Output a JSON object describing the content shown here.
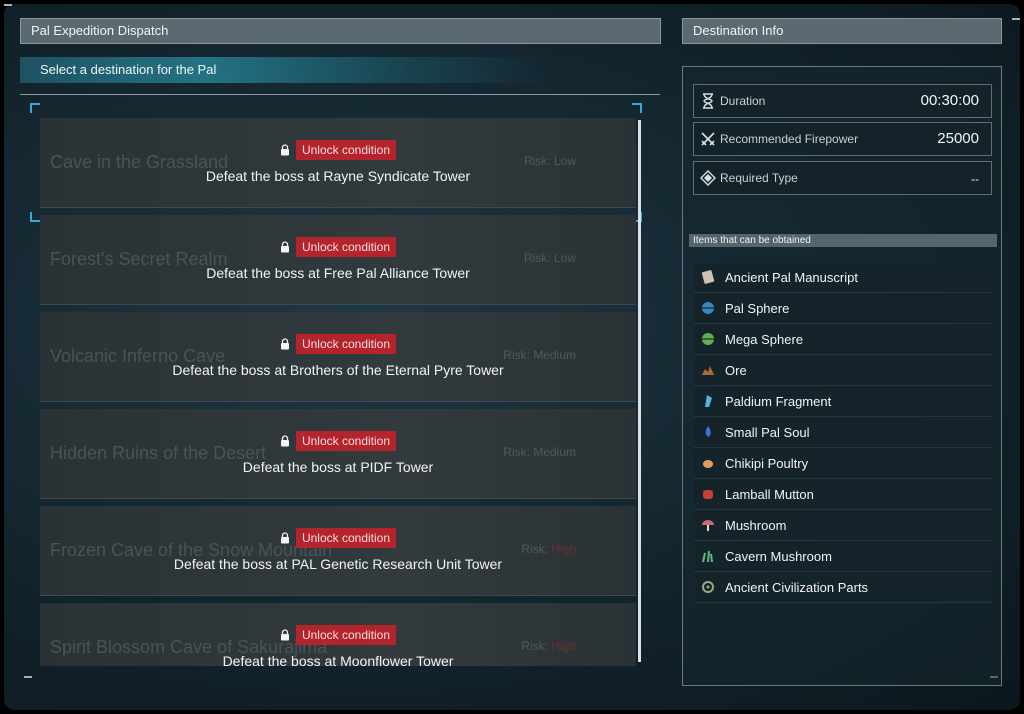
{
  "expedition": {
    "title": "Pal Expedition Dispatch",
    "subtitle": "Select a destination for the Pal",
    "destinations": [
      {
        "name": "Cave in the Grassland",
        "risk_label": "Risk:",
        "risk": "Low",
        "unlock_label": "Unlock condition",
        "condition": "Defeat the boss at Rayne Syndicate Tower"
      },
      {
        "name": "Forest's Secret Realm",
        "risk_label": "Risk:",
        "risk": "Low",
        "unlock_label": "Unlock condition",
        "condition": "Defeat the boss at Free Pal Alliance Tower"
      },
      {
        "name": "Volcanic Inferno Cave",
        "risk_label": "Risk:",
        "risk": "Medium",
        "unlock_label": "Unlock condition",
        "condition": "Defeat the boss at Brothers of the Eternal Pyre Tower"
      },
      {
        "name": "Hidden Ruins of the Desert",
        "risk_label": "Risk:",
        "risk": "Medium",
        "unlock_label": "Unlock condition",
        "condition": "Defeat the boss at PIDF Tower"
      },
      {
        "name": "Frozen Cave of the Snow Mountain",
        "risk_label": "Risk:",
        "risk": "High",
        "unlock_label": "Unlock condition",
        "condition": "Defeat the boss at PAL Genetic Research Unit Tower"
      },
      {
        "name": "Spirit Blossom Cave of Sakurajima",
        "risk_label": "Risk:",
        "risk": "High",
        "unlock_label": "Unlock condition",
        "condition": "Defeat the boss at Moonflower Tower"
      }
    ]
  },
  "info": {
    "title": "Destination Info",
    "duration_label": "Duration",
    "duration_value": "00:30:00",
    "firepower_label": "Recommended Firepower",
    "firepower_value": "25000",
    "type_label": "Required Type",
    "type_value": "--",
    "items_header": "Items that can be obtained",
    "items": [
      {
        "name": "Ancient Pal Manuscript",
        "icon": "manuscript-icon"
      },
      {
        "name": "Pal Sphere",
        "icon": "pal-sphere-icon"
      },
      {
        "name": "Mega Sphere",
        "icon": "mega-sphere-icon"
      },
      {
        "name": "Ore",
        "icon": "ore-icon"
      },
      {
        "name": "Paldium Fragment",
        "icon": "paldium-icon"
      },
      {
        "name": "Small Pal Soul",
        "icon": "pal-soul-icon"
      },
      {
        "name": "Chikipi Poultry",
        "icon": "poultry-icon"
      },
      {
        "name": "Lamball Mutton",
        "icon": "mutton-icon"
      },
      {
        "name": "Mushroom",
        "icon": "mushroom-icon"
      },
      {
        "name": "Cavern Mushroom",
        "icon": "cavern-mushroom-icon"
      },
      {
        "name": "Ancient Civilization Parts",
        "icon": "civilization-parts-icon"
      }
    ]
  },
  "colors": {
    "accent": "#3aa8d6",
    "unlock_badge": "#b3242c",
    "header": "#5b6a71"
  }
}
